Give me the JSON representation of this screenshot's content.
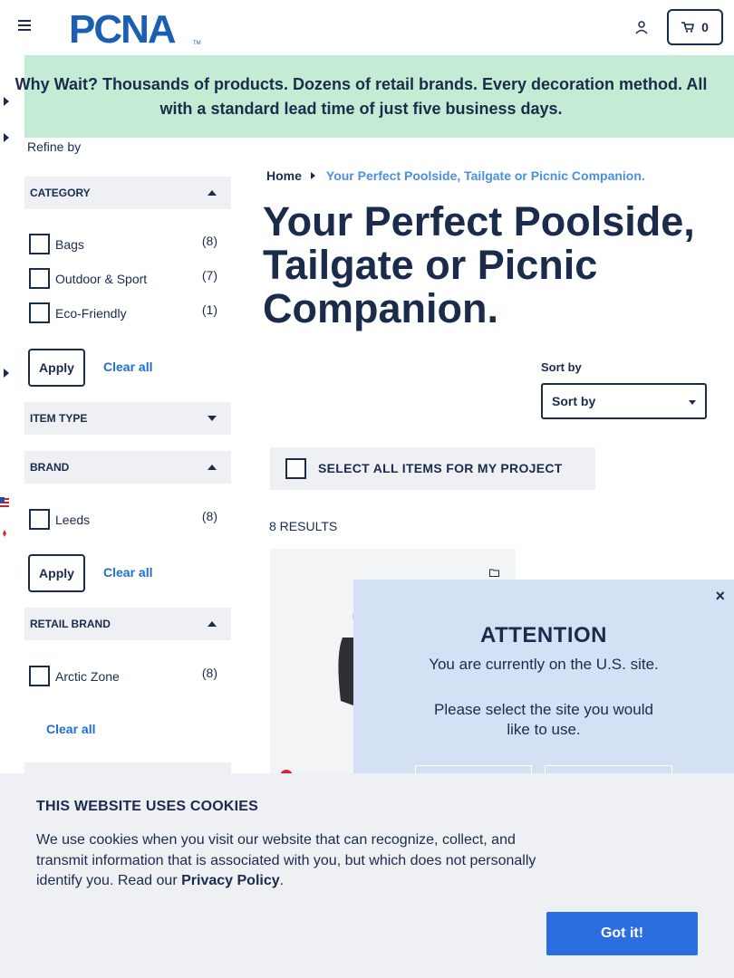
{
  "header": {
    "logo_text": "PCNA",
    "cart_count": "0"
  },
  "banner": {
    "text": "Why Wait? Thousands of products. Dozens of retail brands. Every decoration method. All with a standard lead time of just five business days."
  },
  "filters": {
    "refine_label": "Refine by",
    "category": {
      "title": "CATEGORY",
      "items": [
        {
          "label": "Bags",
          "count": "(8)"
        },
        {
          "label": "Outdoor & Sport",
          "count": "(7)"
        },
        {
          "label": "Eco-Friendly",
          "count": "(1)"
        }
      ],
      "apply": "Apply",
      "clear": "Clear all"
    },
    "item_type": {
      "title": "ITEM TYPE"
    },
    "brand": {
      "title": "BRAND",
      "items": [
        {
          "label": "Leeds",
          "count": "(8)"
        }
      ],
      "apply": "Apply",
      "clear": "Clear all"
    },
    "retail_brand": {
      "title": "RETAIL BRAND",
      "items": [
        {
          "label": "Arctic Zone",
          "count": "(8)"
        }
      ],
      "clear": "Clear all"
    }
  },
  "breadcrumb": {
    "home": "Home",
    "current": "Your Perfect Poolside, Tailgate or Picnic Companion."
  },
  "page_title": "Your Perfect Poolside, Tailgate or Picnic Companion.",
  "sort": {
    "label": "Sort by",
    "selected": "Sort by"
  },
  "select_all": "SELECT ALL ITEMS FOR MY PROJECT",
  "results": "8 RESULTS",
  "modal": {
    "close": "×",
    "title": "ATTENTION",
    "message": "You are currently on the U.S. site.",
    "question": "Please select the site you would like to use."
  },
  "cookie": {
    "title": "THIS WEBSITE USES COOKIES",
    "text": "We use cookies when you visit our website that can recognize, collect, and transmit information that is associated with you, but which does not personally identify you. Read our",
    "link": "Privacy Policy",
    "period": ".",
    "button": "Got it!"
  },
  "colors": {
    "navy": "#1a2b4c",
    "banner_green": "#c4ecd4",
    "link_blue": "#1f6fd1",
    "button_blue": "#2a6ee0",
    "modal_bg": "#d4e1f4"
  }
}
